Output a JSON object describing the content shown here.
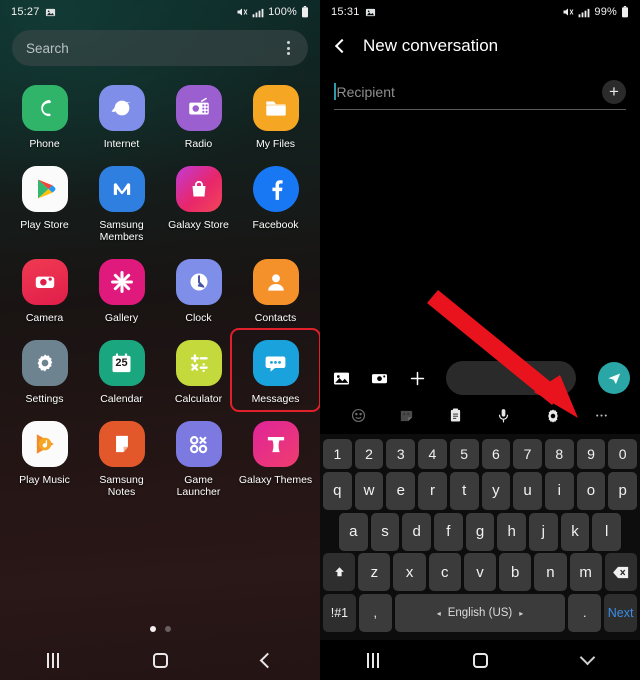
{
  "left_panel": {
    "status_bar": {
      "time": "15:27",
      "battery_percent": "100%",
      "icons": [
        "screenshot-icon",
        "mute-icon",
        "signal-icon",
        "battery-icon"
      ]
    },
    "search": {
      "placeholder": "Search",
      "menu_icon": "kebab-menu-icon"
    },
    "apps": [
      {
        "label": "Phone",
        "icon": "phone-icon"
      },
      {
        "label": "Internet",
        "icon": "internet-icon"
      },
      {
        "label": "Radio",
        "icon": "radio-icon"
      },
      {
        "label": "My Files",
        "icon": "my-files-icon"
      },
      {
        "label": "Play Store",
        "icon": "play-store-icon"
      },
      {
        "label": "Samsung Members",
        "icon": "samsung-members-icon"
      },
      {
        "label": "Galaxy Store",
        "icon": "galaxy-store-icon"
      },
      {
        "label": "Facebook",
        "icon": "facebook-icon"
      },
      {
        "label": "Camera",
        "icon": "camera-icon"
      },
      {
        "label": "Gallery",
        "icon": "gallery-icon"
      },
      {
        "label": "Clock",
        "icon": "clock-icon"
      },
      {
        "label": "Contacts",
        "icon": "contacts-icon"
      },
      {
        "label": "Settings",
        "icon": "settings-icon"
      },
      {
        "label": "Calendar",
        "icon": "calendar-icon"
      },
      {
        "label": "Calculator",
        "icon": "calculator-icon"
      },
      {
        "label": "Messages",
        "icon": "messages-icon"
      },
      {
        "label": "Play Music",
        "icon": "play-music-icon"
      },
      {
        "label": "Samsung Notes",
        "icon": "samsung-notes-icon"
      },
      {
        "label": "Game Launcher",
        "icon": "game-launcher-icon"
      },
      {
        "label": "Galaxy Themes",
        "icon": "galaxy-themes-icon"
      }
    ],
    "highlight": {
      "target_label": "Messages",
      "color": "#e0202a"
    },
    "calendar_day": "25",
    "page_indicator": {
      "pages": 2,
      "active": 1
    },
    "nav_bar": [
      "recents-icon",
      "home-icon",
      "back-icon"
    ]
  },
  "right_panel": {
    "status_bar": {
      "time": "15:31",
      "battery_percent": "99%",
      "icons": [
        "screenshot-icon",
        "mute-icon",
        "signal-icon",
        "battery-icon"
      ]
    },
    "app_bar": {
      "back_icon": "back-chevron-icon",
      "title": "New conversation"
    },
    "recipient_field": {
      "placeholder": "Recipient",
      "add_icon": "plus-icon"
    },
    "composer": {
      "attach_icons": [
        "image-icon",
        "camera-icon",
        "plus-icon"
      ],
      "message_placeholder": "",
      "send_icon": "send-icon",
      "send_color": "#2aa6a6"
    },
    "keyboard_toolbar": [
      "emoji-icon",
      "sticker-icon",
      "clipboard-icon",
      "microphone-icon",
      "gear-icon",
      "more-icon"
    ],
    "annotation_arrow": {
      "points_to": "gear-icon",
      "color": "#e8131c"
    },
    "keyboard": {
      "row_numbers": [
        "1",
        "2",
        "3",
        "4",
        "5",
        "6",
        "7",
        "8",
        "9",
        "0"
      ],
      "row_top": [
        "q",
        "w",
        "e",
        "r",
        "t",
        "y",
        "u",
        "i",
        "o",
        "p"
      ],
      "row_home": [
        "a",
        "s",
        "d",
        "f",
        "g",
        "h",
        "j",
        "k",
        "l"
      ],
      "row_bottom": [
        "z",
        "x",
        "c",
        "v",
        "b",
        "n",
        "m"
      ],
      "shift_key": "shift-icon",
      "backspace_key": "backspace-icon",
      "symbols_key": "!#1",
      "comma_key": ",",
      "space_key": "English (US)",
      "period_key": ".",
      "action_key": "Next"
    },
    "nav_bar": [
      "recents-icon",
      "home-icon",
      "hide-keyboard-icon"
    ]
  }
}
